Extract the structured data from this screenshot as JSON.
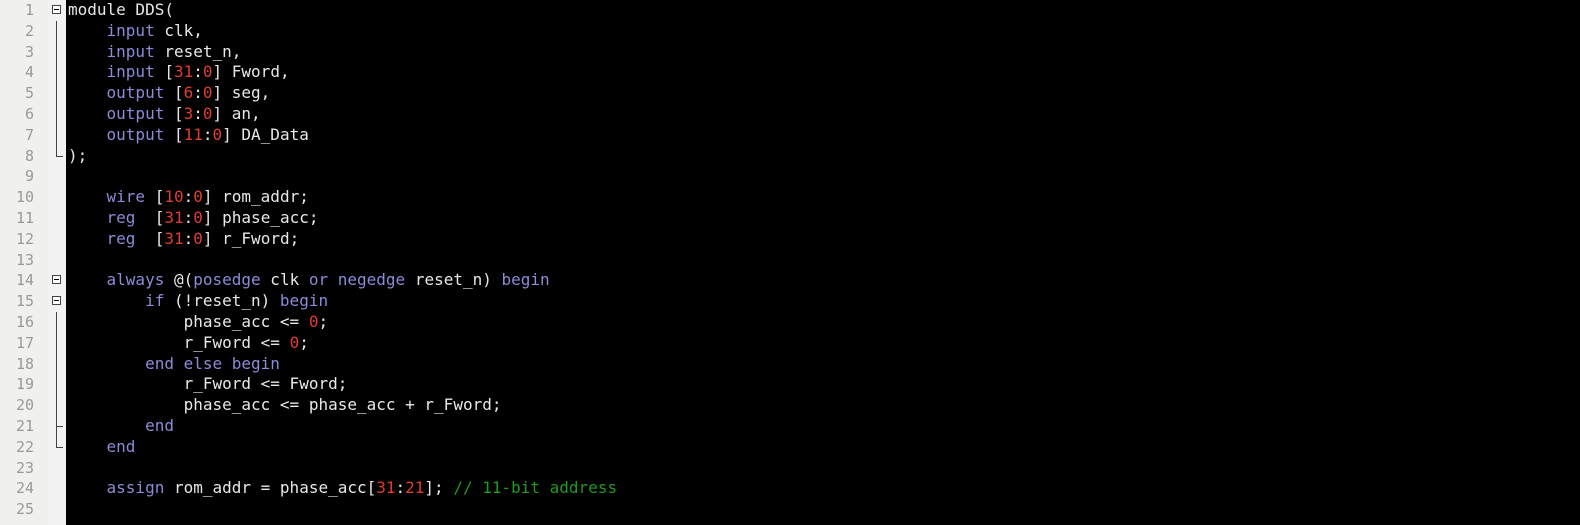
{
  "editor": {
    "line_numbers": [
      "1",
      "2",
      "3",
      "4",
      "5",
      "6",
      "7",
      "8",
      "9",
      "10",
      "11",
      "12",
      "13",
      "14",
      "15",
      "16",
      "17",
      "18",
      "19",
      "20",
      "21",
      "22",
      "23",
      "24",
      "25"
    ],
    "colors": {
      "background": "#000000",
      "gutter": "#f0f0ec",
      "keyword": "#8b8bd8",
      "number": "#e03c2c",
      "identifier": "#e8e8e8",
      "comment": "#1e9a1e"
    },
    "lines": [
      [
        {
          "t": "txt",
          "v": "module DDS("
        }
      ],
      [
        {
          "t": "kw",
          "v": "    input"
        },
        {
          "t": "txt",
          "v": " clk,"
        }
      ],
      [
        {
          "t": "kw",
          "v": "    input"
        },
        {
          "t": "txt",
          "v": " reset_n,"
        }
      ],
      [
        {
          "t": "kw",
          "v": "    input"
        },
        {
          "t": "txt",
          "v": " ["
        },
        {
          "t": "num",
          "v": "31"
        },
        {
          "t": "txt",
          "v": ":"
        },
        {
          "t": "num",
          "v": "0"
        },
        {
          "t": "txt",
          "v": "] Fword,"
        }
      ],
      [
        {
          "t": "kw",
          "v": "    output"
        },
        {
          "t": "txt",
          "v": " ["
        },
        {
          "t": "num",
          "v": "6"
        },
        {
          "t": "txt",
          "v": ":"
        },
        {
          "t": "num",
          "v": "0"
        },
        {
          "t": "txt",
          "v": "] seg,"
        }
      ],
      [
        {
          "t": "kw",
          "v": "    output"
        },
        {
          "t": "txt",
          "v": " ["
        },
        {
          "t": "num",
          "v": "3"
        },
        {
          "t": "txt",
          "v": ":"
        },
        {
          "t": "num",
          "v": "0"
        },
        {
          "t": "txt",
          "v": "] an,"
        }
      ],
      [
        {
          "t": "kw",
          "v": "    output"
        },
        {
          "t": "txt",
          "v": " ["
        },
        {
          "t": "num",
          "v": "11"
        },
        {
          "t": "txt",
          "v": ":"
        },
        {
          "t": "num",
          "v": "0"
        },
        {
          "t": "txt",
          "v": "] DA_Data"
        }
      ],
      [
        {
          "t": "txt",
          "v": ");"
        }
      ],
      [
        {
          "t": "txt",
          "v": ""
        }
      ],
      [
        {
          "t": "kw",
          "v": "    wire"
        },
        {
          "t": "txt",
          "v": " ["
        },
        {
          "t": "num",
          "v": "10"
        },
        {
          "t": "txt",
          "v": ":"
        },
        {
          "t": "num",
          "v": "0"
        },
        {
          "t": "txt",
          "v": "] rom_addr;"
        }
      ],
      [
        {
          "t": "kw",
          "v": "    reg"
        },
        {
          "t": "txt",
          "v": "  ["
        },
        {
          "t": "num",
          "v": "31"
        },
        {
          "t": "txt",
          "v": ":"
        },
        {
          "t": "num",
          "v": "0"
        },
        {
          "t": "txt",
          "v": "] phase_acc;"
        }
      ],
      [
        {
          "t": "kw",
          "v": "    reg"
        },
        {
          "t": "txt",
          "v": "  ["
        },
        {
          "t": "num",
          "v": "31"
        },
        {
          "t": "txt",
          "v": ":"
        },
        {
          "t": "num",
          "v": "0"
        },
        {
          "t": "txt",
          "v": "] r_Fword;"
        }
      ],
      [
        {
          "t": "txt",
          "v": ""
        }
      ],
      [
        {
          "t": "kw",
          "v": "    always"
        },
        {
          "t": "txt",
          "v": " @("
        },
        {
          "t": "kw",
          "v": "posedge"
        },
        {
          "t": "txt",
          "v": " clk "
        },
        {
          "t": "kw",
          "v": "or"
        },
        {
          "t": "txt",
          "v": " "
        },
        {
          "t": "kw",
          "v": "negedge"
        },
        {
          "t": "txt",
          "v": " reset_n) "
        },
        {
          "t": "kw",
          "v": "begin"
        }
      ],
      [
        {
          "t": "kw",
          "v": "        if"
        },
        {
          "t": "txt",
          "v": " (!reset_n) "
        },
        {
          "t": "kw",
          "v": "begin"
        }
      ],
      [
        {
          "t": "txt",
          "v": "            phase_acc <= "
        },
        {
          "t": "num",
          "v": "0"
        },
        {
          "t": "txt",
          "v": ";"
        }
      ],
      [
        {
          "t": "txt",
          "v": "            r_Fword <= "
        },
        {
          "t": "num",
          "v": "0"
        },
        {
          "t": "txt",
          "v": ";"
        }
      ],
      [
        {
          "t": "kw",
          "v": "        end else begin"
        }
      ],
      [
        {
          "t": "txt",
          "v": "            r_Fword <= Fword;"
        }
      ],
      [
        {
          "t": "txt",
          "v": "            phase_acc <= phase_acc + r_Fword;"
        }
      ],
      [
        {
          "t": "kw",
          "v": "        end"
        }
      ],
      [
        {
          "t": "kw",
          "v": "    end"
        }
      ],
      [
        {
          "t": "txt",
          "v": ""
        }
      ],
      [
        {
          "t": "kw",
          "v": "    assign"
        },
        {
          "t": "txt",
          "v": " rom_addr = phase_acc["
        },
        {
          "t": "num",
          "v": "31"
        },
        {
          "t": "txt",
          "v": ":"
        },
        {
          "t": "num",
          "v": "21"
        },
        {
          "t": "txt",
          "v": "]; "
        },
        {
          "t": "cm",
          "v": "// 11-bit address"
        }
      ],
      [
        {
          "t": "txt",
          "v": ""
        }
      ]
    ],
    "folds": [
      "box",
      "line",
      "line",
      "line",
      "line",
      "line",
      "line",
      "end",
      "",
      "",
      "",
      "",
      "",
      "box",
      "box",
      "line",
      "line",
      "line",
      "line",
      "line",
      "tick",
      "end",
      "",
      "",
      ""
    ]
  }
}
